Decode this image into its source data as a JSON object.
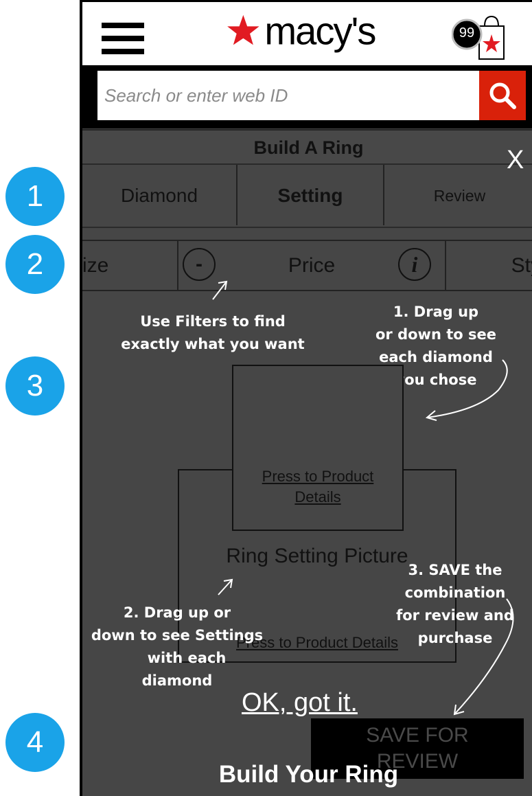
{
  "steps": [
    "1",
    "2",
    "3",
    "4"
  ],
  "header": {
    "brand": "macy's",
    "cart_count": "99"
  },
  "search": {
    "placeholder": "Search or enter web ID"
  },
  "builder": {
    "title": "Build A Ring",
    "close_label": "X",
    "tabs": [
      {
        "label": "Diamond"
      },
      {
        "label": "Setting"
      },
      {
        "label": "Review"
      }
    ],
    "filters": {
      "size_label": "ize",
      "minus_label": "-",
      "price_label": "Price",
      "info_label": "i",
      "style_label": "Sty"
    }
  },
  "annotations": {
    "filters_tip": [
      "Use Filters to find",
      "exactly what you want"
    ],
    "drag_diamond_tip": [
      "1. Drag up",
      "or down to see",
      "each diamond",
      "you chose"
    ],
    "drag_setting_tip": [
      "2. Drag up or",
      "down to see Settings",
      "with each",
      "diamond"
    ],
    "save_tip": [
      "3. SAVE the",
      "combination",
      "for review and",
      "purchase"
    ]
  },
  "product": {
    "diamond_link": [
      "Press to Product",
      "Details"
    ],
    "setting_picture_label": "Ring Setting Picture",
    "setting_link": "Press to Product Details"
  },
  "actions": {
    "ok_label": "OK, got it.",
    "save_label": [
      "SAVE FOR",
      "REVIEW"
    ]
  },
  "footer": {
    "title": "Build Your Ring"
  },
  "colors": {
    "step_badge": "#1aa3e8",
    "brand_red": "#e11b22",
    "search_button": "#d9210a",
    "overlay": "#464646"
  }
}
